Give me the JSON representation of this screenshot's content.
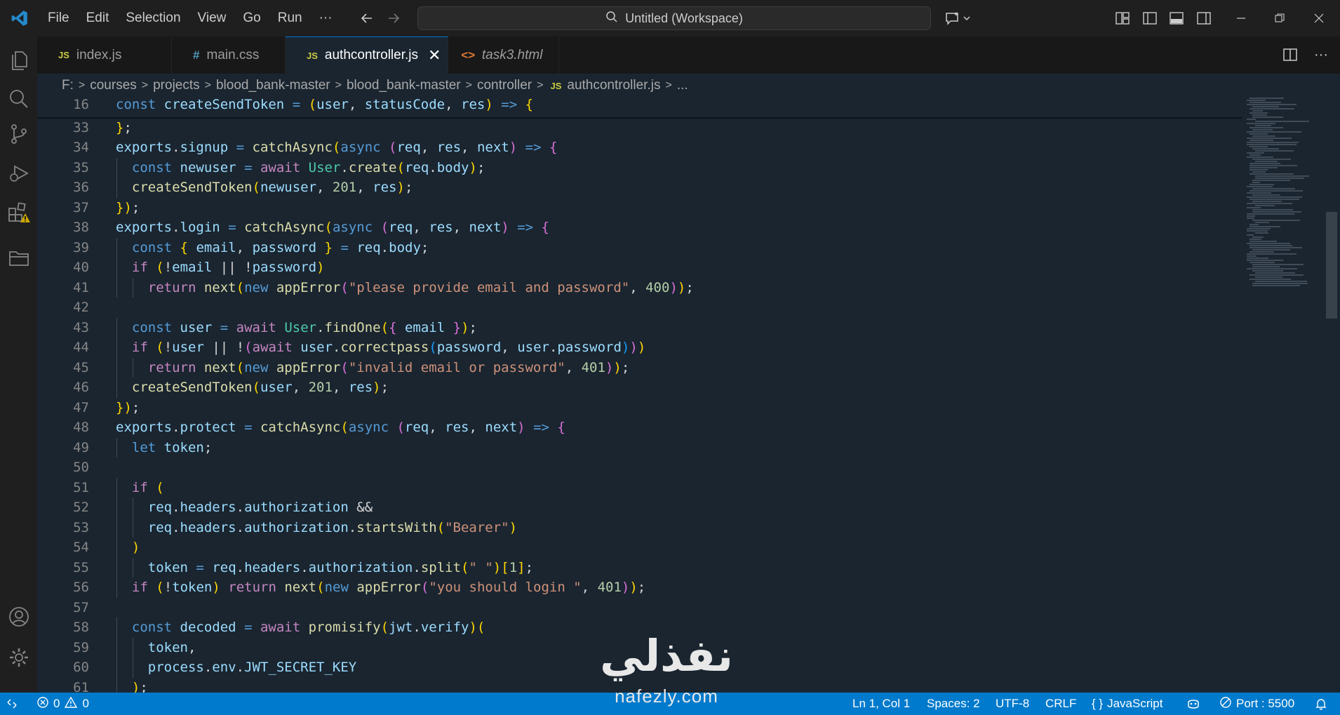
{
  "menu": [
    "File",
    "Edit",
    "Selection",
    "View",
    "Go",
    "Run",
    "···"
  ],
  "command_center": "Untitled (Workspace)",
  "tabs": [
    {
      "label": "index.js",
      "icon": "JS",
      "type": "js"
    },
    {
      "label": "main.css",
      "icon": "#",
      "type": "css"
    },
    {
      "label": "authcontroller.js",
      "icon": "JS",
      "type": "js",
      "active": true
    },
    {
      "label": "task3.html",
      "icon": "<>",
      "type": "html"
    }
  ],
  "tab_close": "✕",
  "breadcrumb": [
    "F:",
    "courses",
    "projects",
    "blood_bank-master",
    "blood_bank-master",
    "controller",
    "authcontroller.js",
    "..."
  ],
  "breadcrumb_file_icon": "JS",
  "editor_lines": [
    {
      "num": "16",
      "text": "const createSendToken = (user, statusCode, res) => {"
    },
    {
      "num": "33",
      "text": "};"
    },
    {
      "num": "34",
      "text": "exports.signup = catchAsync(async (req, res, next) => {"
    },
    {
      "num": "35",
      "text": "  const newuser = await User.create(req.body);"
    },
    {
      "num": "36",
      "text": "  createSendToken(newuser, 201, res);"
    },
    {
      "num": "37",
      "text": "});"
    },
    {
      "num": "38",
      "text": "exports.login = catchAsync(async (req, res, next) => {"
    },
    {
      "num": "39",
      "text": "  const { email, password } = req.body;"
    },
    {
      "num": "40",
      "text": "  if (!email || !password)"
    },
    {
      "num": "41",
      "text": "    return next(new appError(\"please provide email and password\", 400));"
    },
    {
      "num": "42",
      "text": ""
    },
    {
      "num": "43",
      "text": "  const user = await User.findOne({ email });"
    },
    {
      "num": "44",
      "text": "  if (!user || !(await user.correctpass(password, user.password)))"
    },
    {
      "num": "45",
      "text": "    return next(new appError(\"invalid email or password\", 401));"
    },
    {
      "num": "46",
      "text": "  createSendToken(user, 201, res);"
    },
    {
      "num": "47",
      "text": "});"
    },
    {
      "num": "48",
      "text": "exports.protect = catchAsync(async (req, res, next) => {"
    },
    {
      "num": "49",
      "text": "  let token;"
    },
    {
      "num": "50",
      "text": ""
    },
    {
      "num": "51",
      "text": "  if ("
    },
    {
      "num": "52",
      "text": "    req.headers.authorization &&"
    },
    {
      "num": "53",
      "text": "    req.headers.authorization.startsWith(\"Bearer\")"
    },
    {
      "num": "54",
      "text": "  )"
    },
    {
      "num": "55",
      "text": "    token = req.headers.authorization.split(\" \")[1];"
    },
    {
      "num": "56",
      "text": "  if (!token) return next(new appError(\"you should login \", 401));"
    },
    {
      "num": "57",
      "text": ""
    },
    {
      "num": "58",
      "text": "  const decoded = await promisify(jwt.verify)("
    },
    {
      "num": "59",
      "text": "    token,"
    },
    {
      "num": "60",
      "text": "    process.env.JWT_SECRET_KEY"
    },
    {
      "num": "61",
      "text": "  );"
    }
  ],
  "status": {
    "errors": "0",
    "warnings": "0",
    "position": "Ln 1, Col 1",
    "spaces": "Spaces: 2",
    "encoding": "UTF-8",
    "eol": "CRLF",
    "language_icon": "{ }",
    "language": "JavaScript",
    "port": "Port : 5500"
  },
  "watermark": {
    "arabic": "نفذلي",
    "latin": "nafezly.com"
  },
  "colors": {
    "accent": "#0078d4",
    "statusbar": "#007acc",
    "editor_bg": "#1a2530",
    "warning": "#cca700"
  }
}
